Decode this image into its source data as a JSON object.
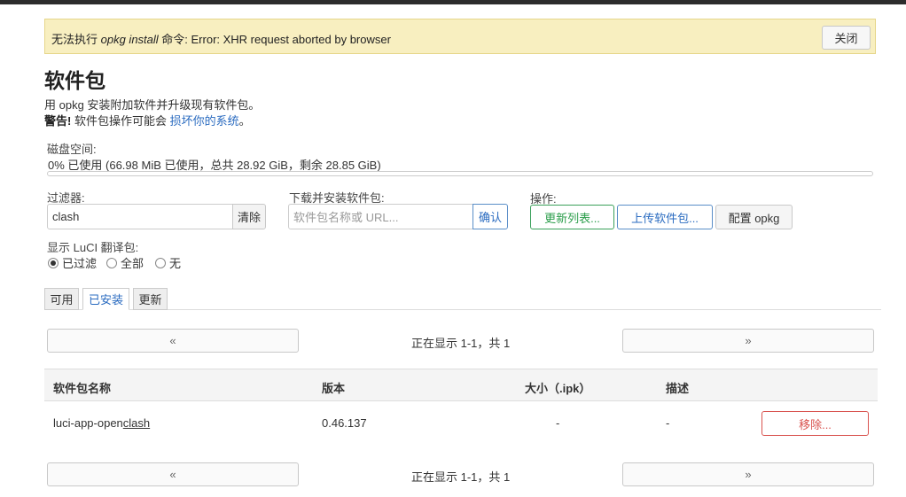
{
  "alert": {
    "prefix": "无法执行 ",
    "command": "opkg install",
    "suffix": " 命令: Error: XHR request aborted by browser",
    "close_label": "关闭"
  },
  "page": {
    "title": "软件包",
    "description": "用 opkg 安装附加软件并升级现有软件包。",
    "warning_label": "警告!",
    "warning_text": " 软件包操作可能会 ",
    "warning_link": "损坏你的系统",
    "warning_end": "。"
  },
  "disk": {
    "label": "磁盘空间:",
    "usage_text": "0% 已使用 (66.98 MiB 已使用，总共 28.92 GiB，剩余 28.85 GiB)",
    "percent_used": 0
  },
  "filter": {
    "label": "过滤器:",
    "value": "clash",
    "clear_label": "清除"
  },
  "download": {
    "label": "下载并安装软件包:",
    "placeholder": "软件包名称或 URL...",
    "confirm_label": "确认"
  },
  "actions": {
    "label": "操作:",
    "update_lists": "更新列表...",
    "upload_package": "上传软件包...",
    "configure_opkg": "配置 opkg"
  },
  "translation": {
    "label": "显示 LuCI 翻译包:",
    "options": [
      "已过滤",
      "全部",
      "无"
    ],
    "selected": "已过滤"
  },
  "tabs": [
    "可用",
    "已安装",
    "更新"
  ],
  "active_tab": "已安装",
  "pager": {
    "prev": "«",
    "next": "»",
    "status": "正在显示 1-1，共 1"
  },
  "table": {
    "headers": [
      "软件包名称",
      "版本",
      "大小（.ipk）",
      "描述"
    ],
    "rows": [
      {
        "name_prefix": "luci-app-open",
        "name_match": "clash",
        "version": "0.46.137",
        "size": "-",
        "description": "-",
        "action": "移除..."
      }
    ]
  },
  "colors": {
    "alert_bg": "#f8efc0",
    "link": "#2a6bc0",
    "danger": "#d9534f",
    "success": "#2a9d4a"
  }
}
